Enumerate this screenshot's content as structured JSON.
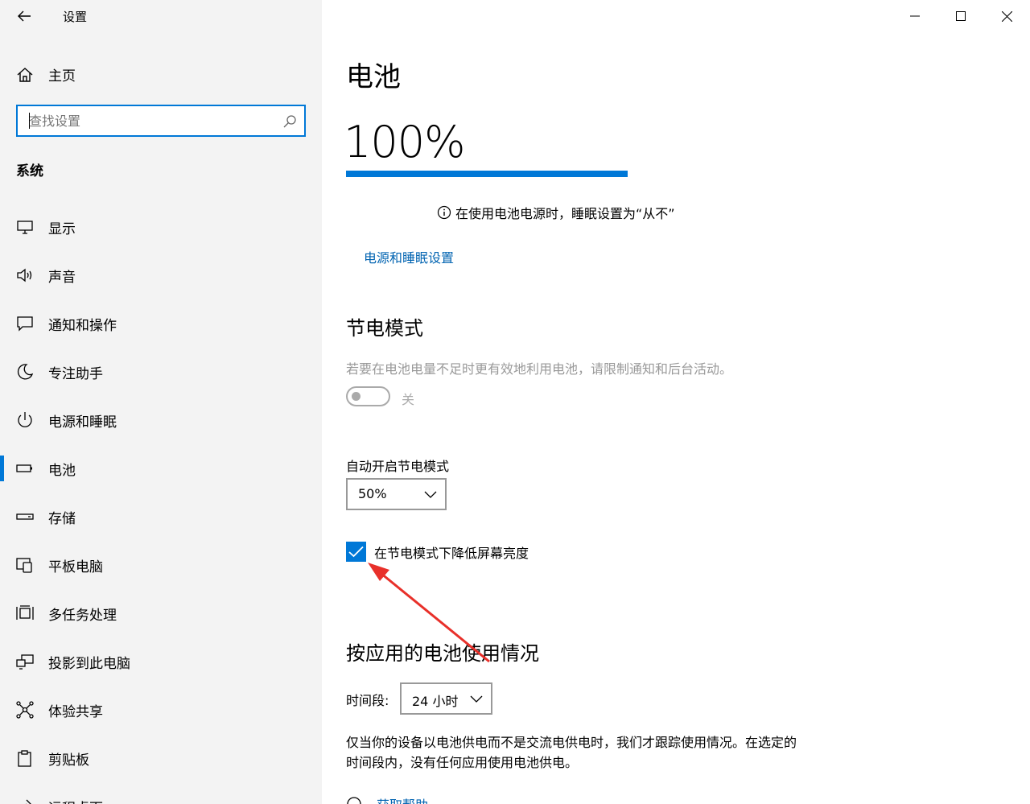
{
  "app": {
    "title": "设置"
  },
  "sidebar": {
    "home_label": "主页",
    "search_placeholder": "查找设置",
    "section": "系统",
    "items": [
      {
        "label": "显示",
        "icon": "monitor-icon"
      },
      {
        "label": "声音",
        "icon": "speaker-icon"
      },
      {
        "label": "通知和操作",
        "icon": "notification-icon"
      },
      {
        "label": "专注助手",
        "icon": "moon-icon"
      },
      {
        "label": "电源和睡眠",
        "icon": "power-icon"
      },
      {
        "label": "电池",
        "icon": "battery-icon",
        "active": true
      },
      {
        "label": "存储",
        "icon": "storage-icon"
      },
      {
        "label": "平板电脑",
        "icon": "tablet-icon"
      },
      {
        "label": "多任务处理",
        "icon": "multitask-icon"
      },
      {
        "label": "投影到此电脑",
        "icon": "project-icon"
      },
      {
        "label": "体验共享",
        "icon": "share-icon"
      },
      {
        "label": "剪贴板",
        "icon": "clipboard-icon"
      },
      {
        "label": "远程桌面",
        "icon": "remote-desktop-icon"
      }
    ]
  },
  "main": {
    "title": "电池",
    "battery_percent": "100%",
    "battery_level": 1.0,
    "info_text": "在使用电池电源时，睡眠设置为“从不”",
    "power_link": "电源和睡眠设置",
    "saver": {
      "heading": "节电模式",
      "description": "若要在电池电量不足时更有效地利用电池，请限制通知和后台活动。",
      "toggle_state": "关",
      "auto_label": "自动开启节电模式",
      "auto_value": "50%",
      "checkbox_label": "在节电模式下降低屏幕亮度",
      "checkbox_checked": true
    },
    "usage": {
      "heading": "按应用的电池使用情况",
      "period_label": "时间段:",
      "period_value": "24 小时",
      "description": "仅当你的设备以电池供电而不是交流电供电时，我们才跟踪使用情况。在选定的时间段内，没有任何应用使用电池供电。",
      "help_link": "获取帮助"
    }
  },
  "colors": {
    "accent": "#0078d7",
    "link": "#0063b1",
    "annotation_arrow": "#e8302a"
  }
}
